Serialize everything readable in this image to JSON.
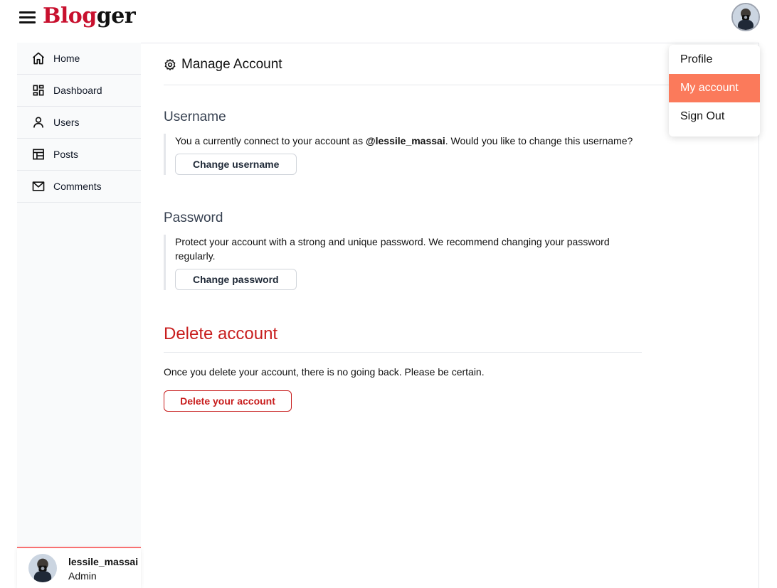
{
  "header": {
    "logo_part1": "Blog",
    "logo_part2": "ger"
  },
  "sidebar": {
    "items": [
      {
        "label": "Home",
        "icon": "home-icon"
      },
      {
        "label": "Dashboard",
        "icon": "dashboard-icon"
      },
      {
        "label": "Users",
        "icon": "user-icon"
      },
      {
        "label": "Posts",
        "icon": "table-icon"
      },
      {
        "label": "Comments",
        "icon": "mail-icon"
      }
    ],
    "user": {
      "name": "lessile_massai",
      "role": "Admin"
    }
  },
  "main": {
    "title": "Manage Account",
    "username": {
      "heading": "Username",
      "text_before": "You a currently connect to your account as ",
      "handle": "@lessile_massai",
      "text_after": ". Would you like to change this username?",
      "button": "Change username"
    },
    "password": {
      "heading": "Password",
      "text": "Protect your account with a strong and unique password. We recommend changing your password regularly.",
      "button": "Change password"
    },
    "delete": {
      "heading": "Delete account",
      "text": "Once you delete your account, there is no going back. Please be certain.",
      "button": "Delete your account"
    }
  },
  "dropdown": {
    "items": [
      {
        "label": "Profile"
      },
      {
        "label": "My account"
      },
      {
        "label": "Sign Out"
      }
    ],
    "active_index": 1
  },
  "colors": {
    "brand_red": "#c8102e",
    "danger": "#c81e1e",
    "dropdown_active": "#fb7a5b"
  }
}
